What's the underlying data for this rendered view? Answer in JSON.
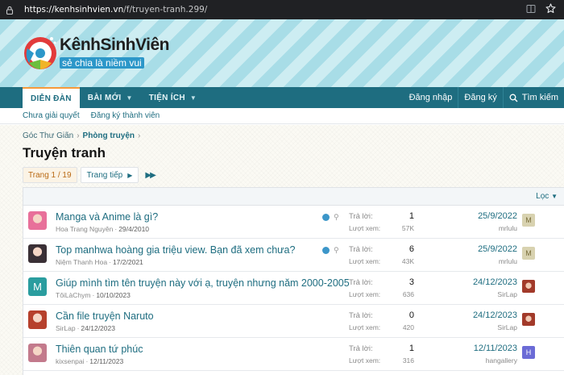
{
  "browser": {
    "url_host": "https://kenhsinhvien.vn",
    "url_path": "/f/truyen-tranh.299/"
  },
  "header": {
    "logo_title": "KênhSinhViên",
    "logo_slogan": "sẻ chia là niềm vui"
  },
  "nav": {
    "tabs": [
      {
        "label": "DIỄN ĐÀN"
      },
      {
        "label": "BÀI MỚI"
      },
      {
        "label": "TIỆN ÍCH"
      }
    ],
    "login": "Đăng nhập",
    "register": "Đăng ký",
    "search": "Tìm kiếm"
  },
  "subnav": {
    "items": [
      "Chưa giải quyết",
      "Đăng ký thành viên"
    ]
  },
  "breadcrumb": [
    "Góc Thư Giãn",
    "Phòng truyện"
  ],
  "page_title": "Truyện tranh",
  "pager": {
    "current": "Trang 1 / 19",
    "next": "Trang tiếp"
  },
  "filter": {
    "label": "Lọc"
  },
  "stats_labels": {
    "replies": "Trả lời:",
    "views": "Lượt xem:"
  },
  "threads": [
    {
      "title": "Manga và Anime là gì?",
      "author": "Hoa Trang Nguyên",
      "date": "29/4/2010",
      "replies": "1",
      "views": "57K",
      "last_date": "25/9/2022",
      "last_user": "mrlulu",
      "last_avatar": "M",
      "has_icons": true,
      "avatar_color": "#e8709a"
    },
    {
      "title": "Top manhwa hoàng gia triệu view. Bạn đã xem chưa?",
      "author": "Niệm Thanh Hoa",
      "date": "17/2/2021",
      "replies": "6",
      "views": "43K",
      "last_date": "25/9/2022",
      "last_user": "mrlulu",
      "last_avatar": "M",
      "has_icons": true,
      "avatar_color": "#3a3036"
    },
    {
      "title": "Giúp mình tìm tên truyện này với ạ, truyện nhưng năm 2000-2005",
      "author": "TôiLàChym",
      "date": "10/10/2023",
      "replies": "3",
      "views": "636",
      "last_date": "24/12/2023",
      "last_user": "SirLap",
      "last_avatar": "",
      "has_icons": false,
      "avatar_color": "#2a9d9f",
      "avatar_letter": "M"
    },
    {
      "title": "Cần file truyện Naruto",
      "author": "SirLap",
      "date": "24/12/2023",
      "replies": "0",
      "views": "420",
      "last_date": "24/12/2023",
      "last_user": "SirLap",
      "last_avatar": "",
      "has_icons": false,
      "avatar_color": "#b6402c"
    },
    {
      "title": "Thiên quan tứ phúc",
      "author": "kixsenpai",
      "date": "12/11/2023",
      "replies": "1",
      "views": "316",
      "last_date": "12/11/2023",
      "last_user": "hangallery",
      "last_avatar": "H",
      "has_icons": false,
      "avatar_color": "#c37a8c"
    }
  ]
}
